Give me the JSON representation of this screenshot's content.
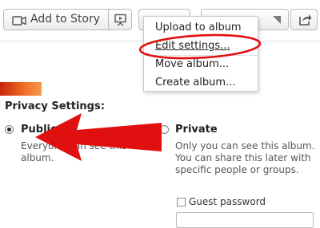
{
  "toolbar": {
    "add_to_story_label": "Add to Story"
  },
  "menu": {
    "items": [
      "Upload to album",
      "Edit settings...",
      "Move album...",
      "Create album..."
    ]
  },
  "privacy": {
    "title": "Privacy Settings:",
    "public": {
      "label": "Public",
      "description": "Everyone can see this album.",
      "selected": true
    },
    "private": {
      "label": "Private",
      "description": "Only you can see this album. You can share this later with specific people or groups.",
      "selected": false
    },
    "guest_password_label": "Guest password",
    "guest_password_value": ""
  },
  "colors": {
    "annotation_red": "#e01010",
    "thumbnail_orange": "#ef6a25"
  },
  "icons": [
    "story-icon",
    "slideshow-icon",
    "dropdown-arrow-icon",
    "share-icon",
    "annotation-arrow",
    "annotation-ellipse"
  ]
}
